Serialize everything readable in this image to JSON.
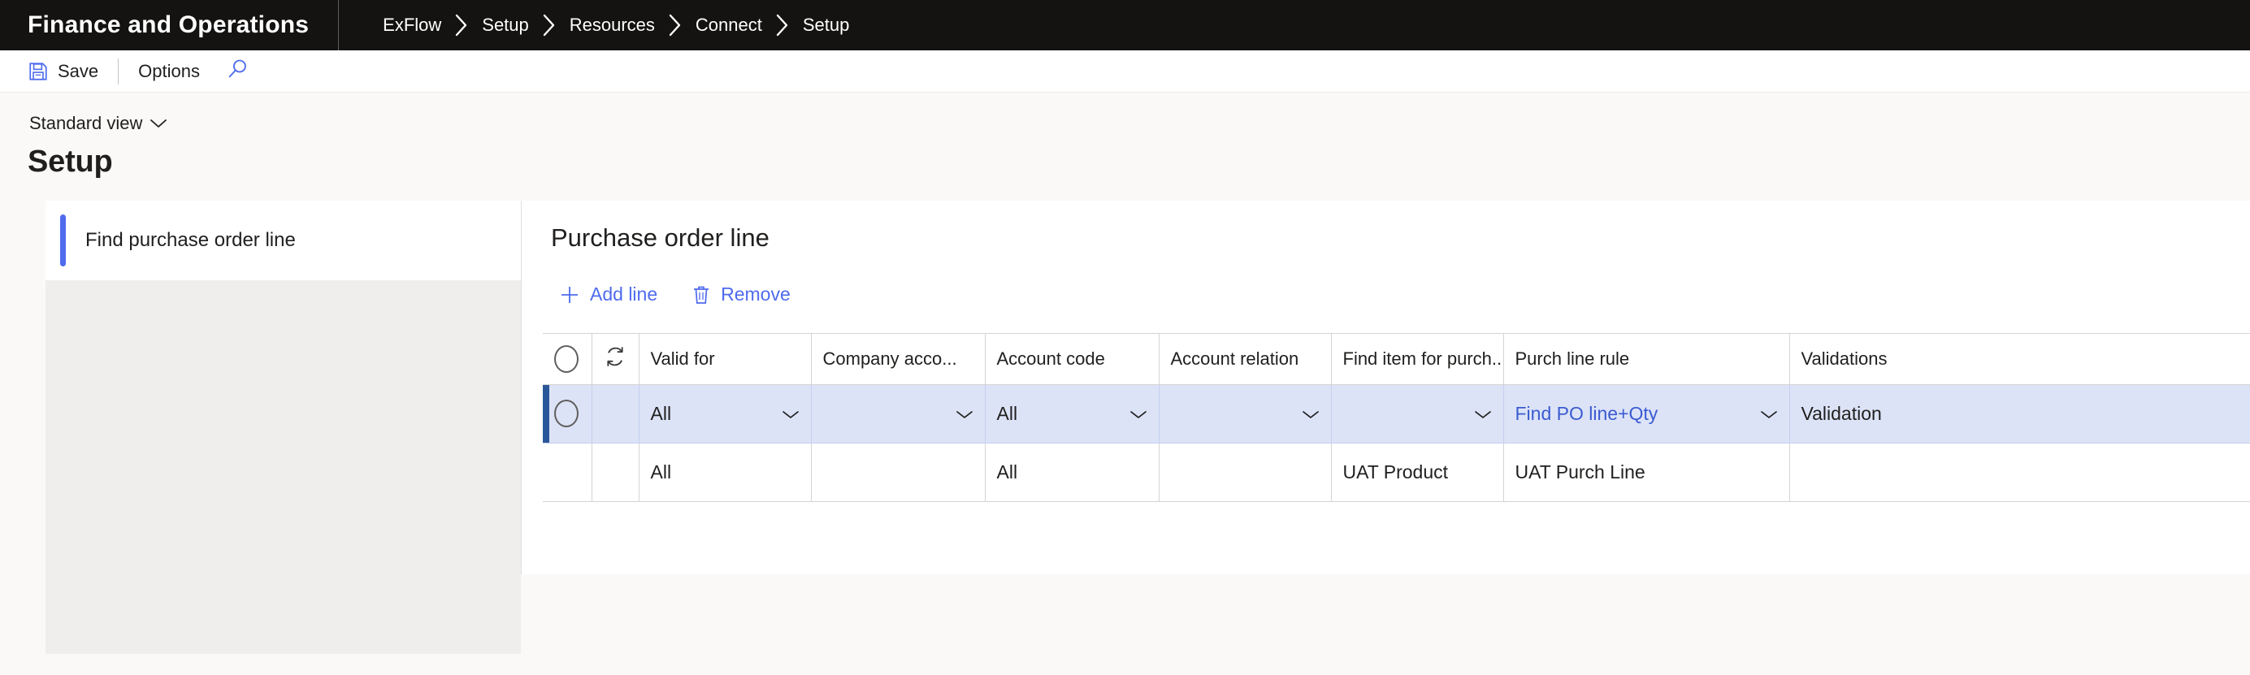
{
  "topbar": {
    "app_title": "Finance and Operations",
    "breadcrumb": [
      "ExFlow",
      "Setup",
      "Resources",
      "Connect",
      "Setup"
    ],
    "background": "#141312"
  },
  "command_bar": {
    "save_label": "Save",
    "save_icon": "save-floppy-icon",
    "options_label": "Options",
    "search_icon": "search-icon"
  },
  "page": {
    "view_selector_label": "Standard view",
    "view_selector_icon": "chevron-down-icon",
    "title": "Setup"
  },
  "left_panel": {
    "items": [
      {
        "label": "Find purchase order line",
        "selected": true
      }
    ],
    "accent_color": "#4f6bed"
  },
  "main_panel": {
    "section_title": "Purchase order line",
    "actions": [
      {
        "label": "Add line",
        "icon": "plus-icon"
      },
      {
        "label": "Remove",
        "icon": "trash-icon"
      }
    ],
    "accent_color": "#4f6bed"
  },
  "grid": {
    "headers": {
      "select": "",
      "refresh_icon": "refresh-icon",
      "valid_for": "Valid for",
      "company_account": "Company acco...",
      "account_code": "Account code",
      "account_relation": "Account relation",
      "find_item": "Find item for purch...",
      "purch_line_rule": "Purch line rule",
      "validations": "Validations"
    },
    "selected_row_color": "#dce3f7",
    "row_indicator_color": "#2b579a",
    "link_color": "#3b5bd0",
    "rows": [
      {
        "selected": true,
        "valid_for": "All",
        "company_account": "",
        "account_code": "All",
        "account_relation": "",
        "find_item": "",
        "purch_line_rule": "Find PO line+Qty",
        "validations": "Validation",
        "valid_for_is_dropdown": true,
        "purch_line_rule_is_link": true,
        "validations_is_link": true
      },
      {
        "selected": false,
        "valid_for": "All",
        "company_account": "",
        "account_code": "All",
        "account_relation": "",
        "find_item": "UAT Product",
        "purch_line_rule": "UAT Purch Line",
        "validations": ""
      }
    ]
  }
}
